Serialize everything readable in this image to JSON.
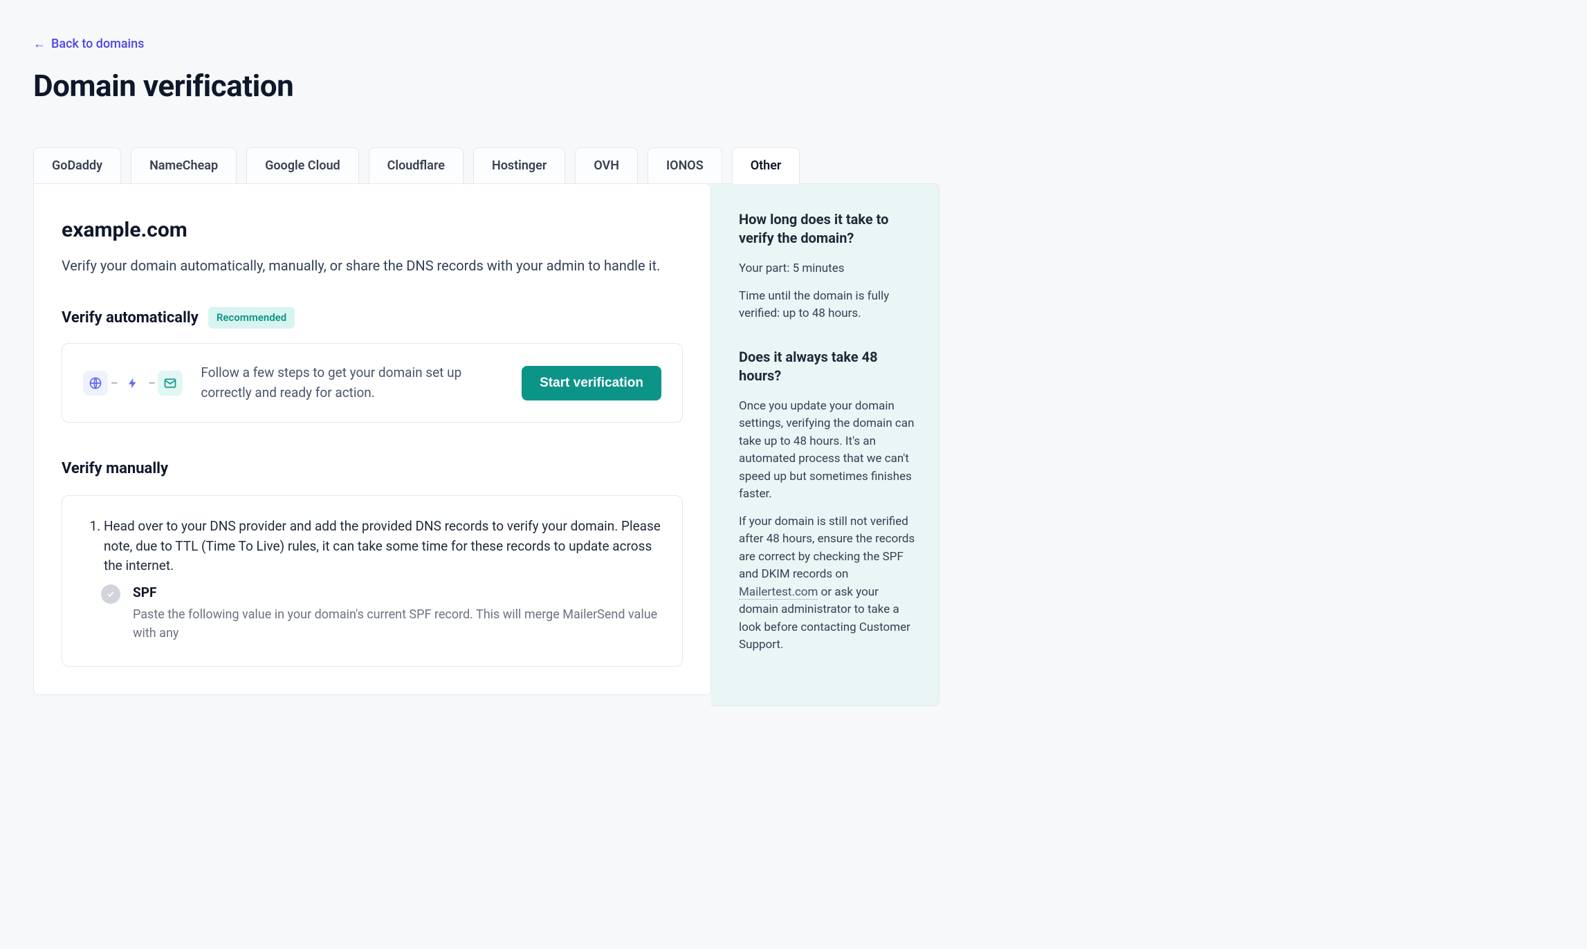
{
  "back_link": "Back to domains",
  "page_title": "Domain verification",
  "tabs": [
    "GoDaddy",
    "NameCheap",
    "Google Cloud",
    "Cloudflare",
    "Hostinger",
    "OVH",
    "IONOS",
    "Other"
  ],
  "active_tab_index": 7,
  "domain": "example.com",
  "lead": "Verify your domain automatically, manually, or share the DNS records with your admin to handle it.",
  "auto": {
    "heading": "Verify automatically",
    "badge": "Recommended",
    "card_text": "Follow a few steps to get your domain set up correctly and ready for action.",
    "button": "Start verification"
  },
  "manual": {
    "heading": "Verify manually",
    "step1": "Head over to your DNS provider and add the provided DNS records to verify your domain. Please note, due to TTL (Time To Live) rules, it can take some time for these records to update across the internet.",
    "spf_title": "SPF",
    "spf_desc": "Paste the following value in your domain's current SPF record. This will merge MailerSend value with any"
  },
  "sidebar": {
    "q1": "How long does it take to verify the domain?",
    "a1a": "Your part: 5 minutes",
    "a1b": "Time until the domain is fully verified: up to 48 hours.",
    "q2": "Does it always take 48 hours?",
    "a2a": "Once you update your domain settings, verifying the domain can take up to 48 hours. It's an automated process that we can't speed up but sometimes finishes faster.",
    "a2b_pre": "If your domain is still not verified after 48 hours, ensure the records are correct by checking the SPF and DKIM records on ",
    "a2b_link": "Mailertest.com",
    "a2b_post": " or ask your domain administrator to take a look before contacting Customer Support."
  }
}
